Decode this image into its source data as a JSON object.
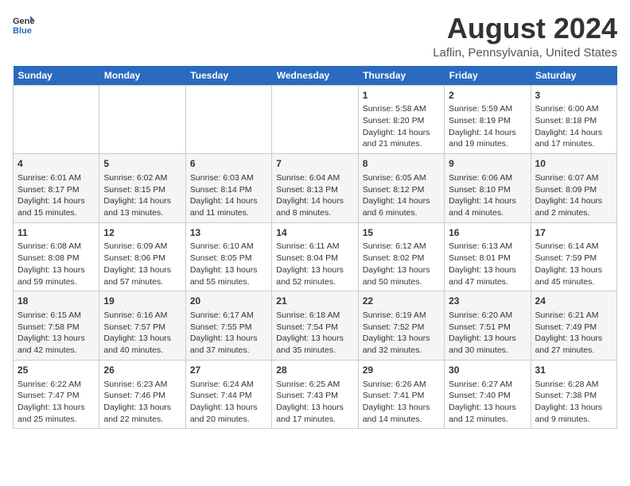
{
  "header": {
    "logo_general": "General",
    "logo_blue": "Blue",
    "main_title": "August 2024",
    "subtitle": "Laflin, Pennsylvania, United States"
  },
  "days_of_week": [
    "Sunday",
    "Monday",
    "Tuesday",
    "Wednesday",
    "Thursday",
    "Friday",
    "Saturday"
  ],
  "weeks": [
    [
      {
        "day": "",
        "info": ""
      },
      {
        "day": "",
        "info": ""
      },
      {
        "day": "",
        "info": ""
      },
      {
        "day": "",
        "info": ""
      },
      {
        "day": "1",
        "info": "Sunrise: 5:58 AM\nSunset: 8:20 PM\nDaylight: 14 hours\nand 21 minutes."
      },
      {
        "day": "2",
        "info": "Sunrise: 5:59 AM\nSunset: 8:19 PM\nDaylight: 14 hours\nand 19 minutes."
      },
      {
        "day": "3",
        "info": "Sunrise: 6:00 AM\nSunset: 8:18 PM\nDaylight: 14 hours\nand 17 minutes."
      }
    ],
    [
      {
        "day": "4",
        "info": "Sunrise: 6:01 AM\nSunset: 8:17 PM\nDaylight: 14 hours\nand 15 minutes."
      },
      {
        "day": "5",
        "info": "Sunrise: 6:02 AM\nSunset: 8:15 PM\nDaylight: 14 hours\nand 13 minutes."
      },
      {
        "day": "6",
        "info": "Sunrise: 6:03 AM\nSunset: 8:14 PM\nDaylight: 14 hours\nand 11 minutes."
      },
      {
        "day": "7",
        "info": "Sunrise: 6:04 AM\nSunset: 8:13 PM\nDaylight: 14 hours\nand 8 minutes."
      },
      {
        "day": "8",
        "info": "Sunrise: 6:05 AM\nSunset: 8:12 PM\nDaylight: 14 hours\nand 6 minutes."
      },
      {
        "day": "9",
        "info": "Sunrise: 6:06 AM\nSunset: 8:10 PM\nDaylight: 14 hours\nand 4 minutes."
      },
      {
        "day": "10",
        "info": "Sunrise: 6:07 AM\nSunset: 8:09 PM\nDaylight: 14 hours\nand 2 minutes."
      }
    ],
    [
      {
        "day": "11",
        "info": "Sunrise: 6:08 AM\nSunset: 8:08 PM\nDaylight: 13 hours\nand 59 minutes."
      },
      {
        "day": "12",
        "info": "Sunrise: 6:09 AM\nSunset: 8:06 PM\nDaylight: 13 hours\nand 57 minutes."
      },
      {
        "day": "13",
        "info": "Sunrise: 6:10 AM\nSunset: 8:05 PM\nDaylight: 13 hours\nand 55 minutes."
      },
      {
        "day": "14",
        "info": "Sunrise: 6:11 AM\nSunset: 8:04 PM\nDaylight: 13 hours\nand 52 minutes."
      },
      {
        "day": "15",
        "info": "Sunrise: 6:12 AM\nSunset: 8:02 PM\nDaylight: 13 hours\nand 50 minutes."
      },
      {
        "day": "16",
        "info": "Sunrise: 6:13 AM\nSunset: 8:01 PM\nDaylight: 13 hours\nand 47 minutes."
      },
      {
        "day": "17",
        "info": "Sunrise: 6:14 AM\nSunset: 7:59 PM\nDaylight: 13 hours\nand 45 minutes."
      }
    ],
    [
      {
        "day": "18",
        "info": "Sunrise: 6:15 AM\nSunset: 7:58 PM\nDaylight: 13 hours\nand 42 minutes."
      },
      {
        "day": "19",
        "info": "Sunrise: 6:16 AM\nSunset: 7:57 PM\nDaylight: 13 hours\nand 40 minutes."
      },
      {
        "day": "20",
        "info": "Sunrise: 6:17 AM\nSunset: 7:55 PM\nDaylight: 13 hours\nand 37 minutes."
      },
      {
        "day": "21",
        "info": "Sunrise: 6:18 AM\nSunset: 7:54 PM\nDaylight: 13 hours\nand 35 minutes."
      },
      {
        "day": "22",
        "info": "Sunrise: 6:19 AM\nSunset: 7:52 PM\nDaylight: 13 hours\nand 32 minutes."
      },
      {
        "day": "23",
        "info": "Sunrise: 6:20 AM\nSunset: 7:51 PM\nDaylight: 13 hours\nand 30 minutes."
      },
      {
        "day": "24",
        "info": "Sunrise: 6:21 AM\nSunset: 7:49 PM\nDaylight: 13 hours\nand 27 minutes."
      }
    ],
    [
      {
        "day": "25",
        "info": "Sunrise: 6:22 AM\nSunset: 7:47 PM\nDaylight: 13 hours\nand 25 minutes."
      },
      {
        "day": "26",
        "info": "Sunrise: 6:23 AM\nSunset: 7:46 PM\nDaylight: 13 hours\nand 22 minutes."
      },
      {
        "day": "27",
        "info": "Sunrise: 6:24 AM\nSunset: 7:44 PM\nDaylight: 13 hours\nand 20 minutes."
      },
      {
        "day": "28",
        "info": "Sunrise: 6:25 AM\nSunset: 7:43 PM\nDaylight: 13 hours\nand 17 minutes."
      },
      {
        "day": "29",
        "info": "Sunrise: 6:26 AM\nSunset: 7:41 PM\nDaylight: 13 hours\nand 14 minutes."
      },
      {
        "day": "30",
        "info": "Sunrise: 6:27 AM\nSunset: 7:40 PM\nDaylight: 13 hours\nand 12 minutes."
      },
      {
        "day": "31",
        "info": "Sunrise: 6:28 AM\nSunset: 7:38 PM\nDaylight: 13 hours\nand 9 minutes."
      }
    ]
  ]
}
